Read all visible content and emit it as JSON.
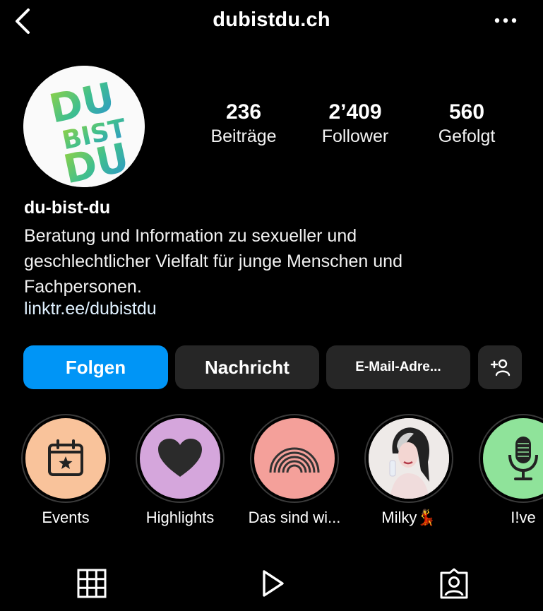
{
  "header": {
    "title": "dubistdu.ch",
    "back_icon": "chevron-left-icon",
    "more_icon": "more-horizontal-icon"
  },
  "profile": {
    "avatar_text": [
      "DU",
      "BIST",
      "DU"
    ],
    "stats": [
      {
        "value": "236",
        "label": "Beiträge"
      },
      {
        "value": "2’409",
        "label": "Follower"
      },
      {
        "value": "560",
        "label": "Gefolgt"
      }
    ],
    "name": "du-bist-du",
    "bio_lines": [
      "Beratung und Information zu sexueller und",
      "geschlechtlicher Vielfalt für junge Menschen und",
      "Fachpersonen."
    ],
    "link": "linktr.ee/dubistdu"
  },
  "actions": {
    "follow": "Folgen",
    "message": "Nachricht",
    "email": "E-Mail-Adre...",
    "add_person_icon": "add-person-icon"
  },
  "highlights": [
    {
      "label": "Events",
      "color": "#f9c39b",
      "icon": "calendar-star-icon"
    },
    {
      "label": "Highlights",
      "color": "#d5a6dc",
      "icon": "heart-icon"
    },
    {
      "label": "Das sind wi...",
      "color": "#f4a09a",
      "icon": "rainbow-icon"
    },
    {
      "label": "Milky💃",
      "color": "#f4f0ee",
      "icon": "photo-avatar"
    },
    {
      "label": "I!ve",
      "color": "#8fe39a",
      "icon": "microphone-icon"
    }
  ],
  "colors": {
    "background": "#000000",
    "follow_button": "#0095f6",
    "secondary_button": "#262626"
  },
  "tabs": [
    "grid-icon",
    "reels-icon",
    "tagged-icon"
  ]
}
